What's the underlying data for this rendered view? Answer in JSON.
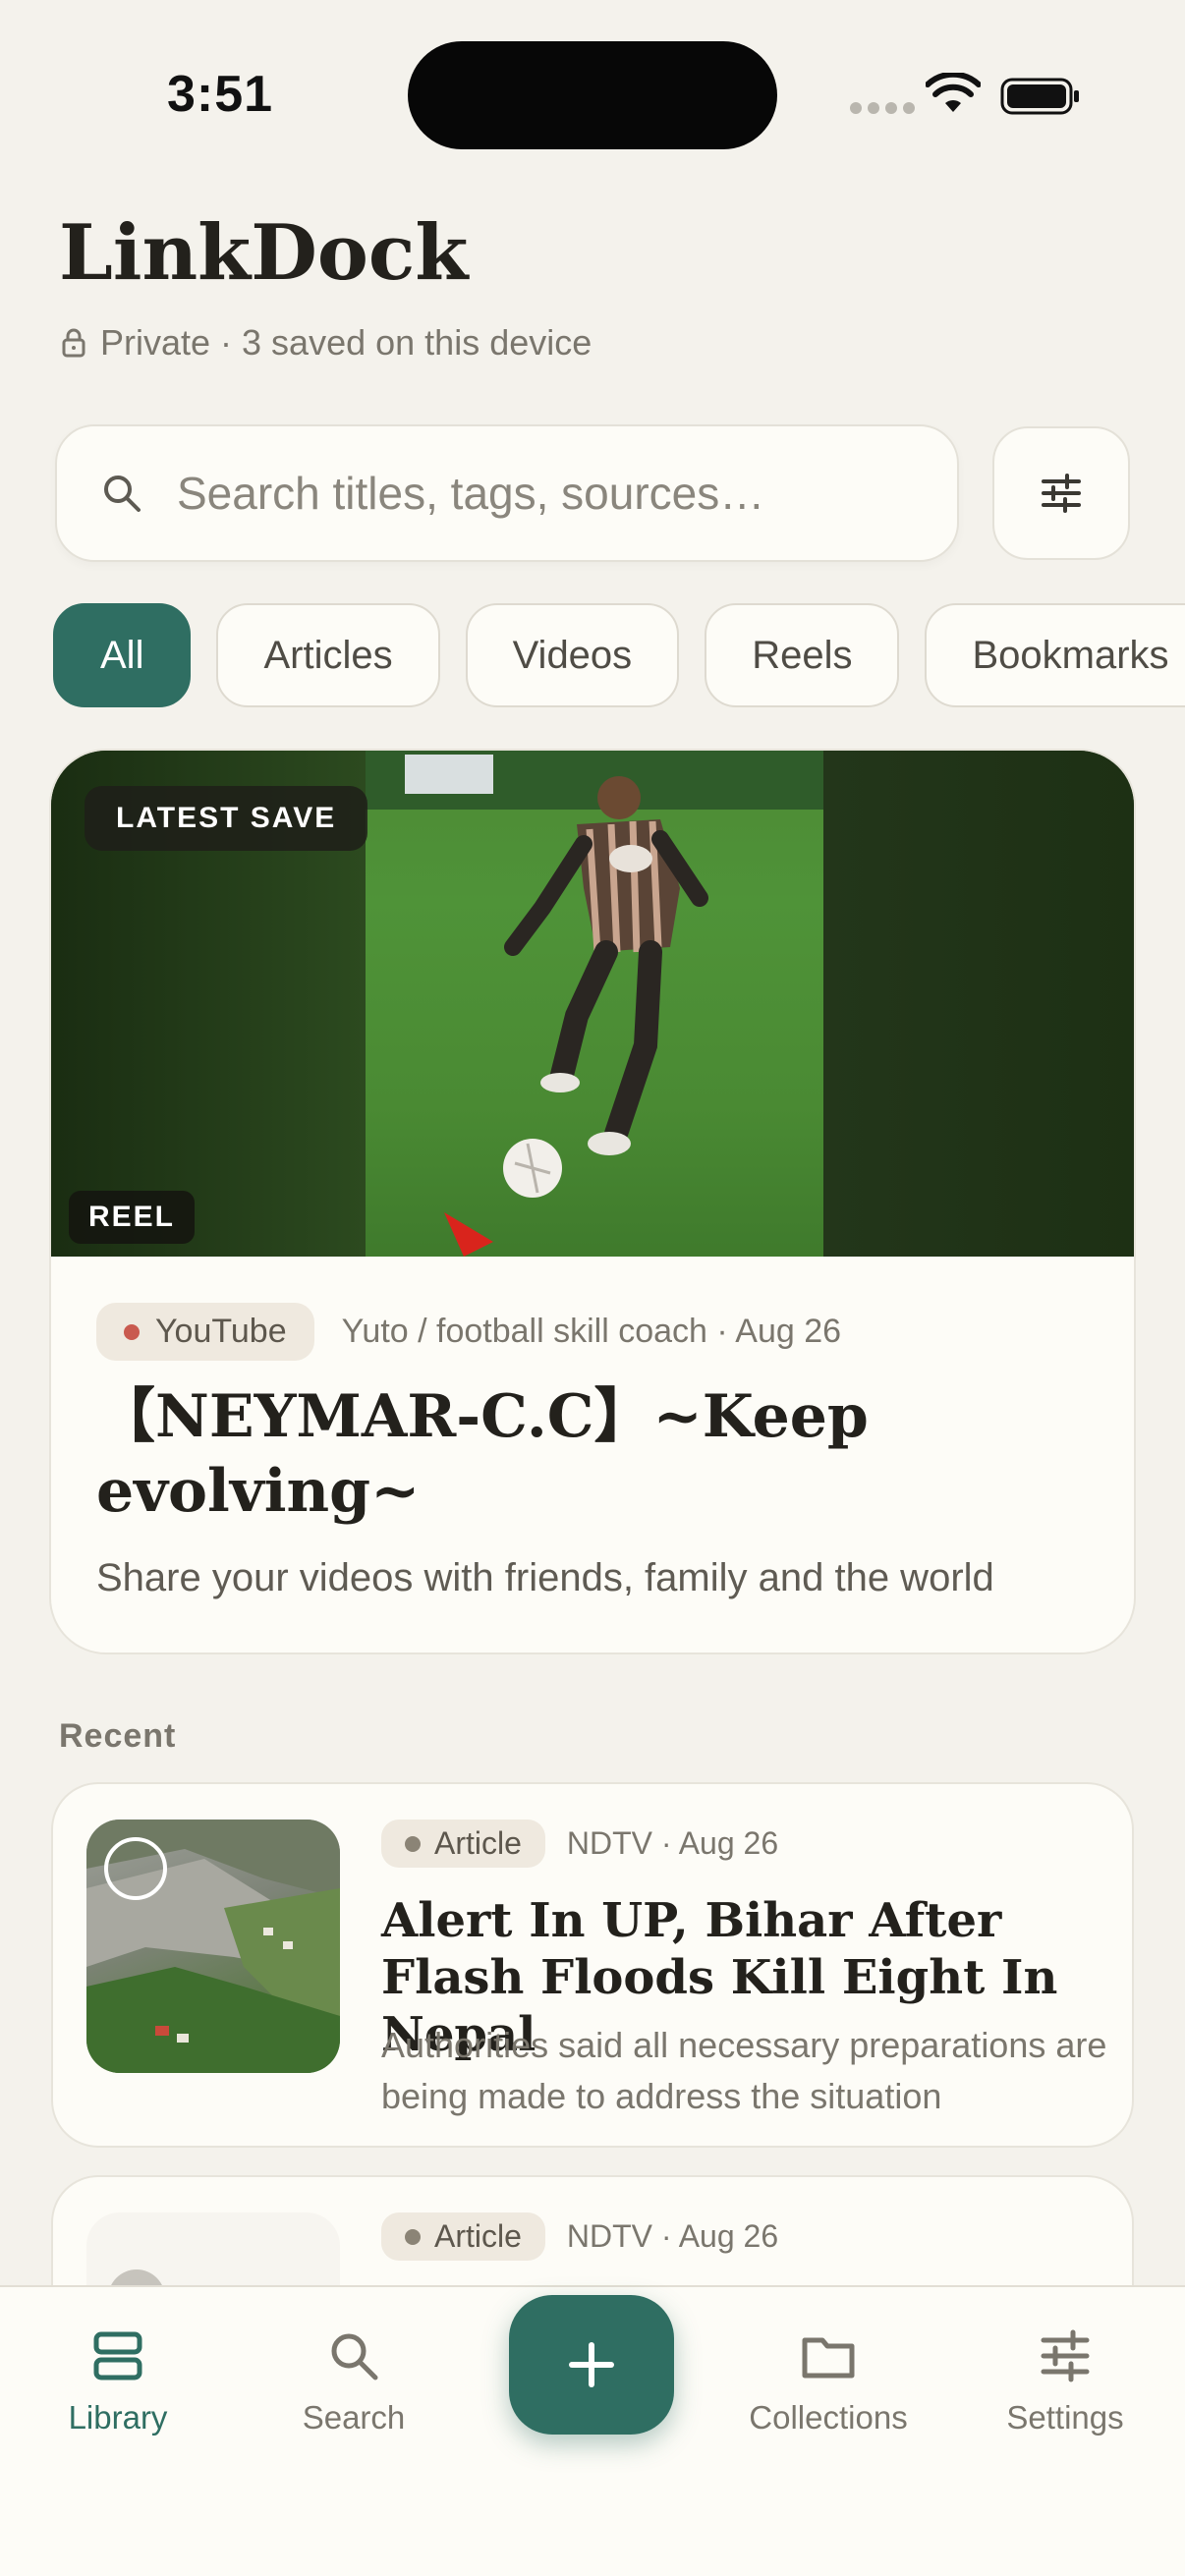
{
  "status_bar": {
    "time": "3:51"
  },
  "header": {
    "title": "LinkDock",
    "privacy_text": "Private · 3 saved on this device"
  },
  "search": {
    "placeholder": "Search titles, tags, sources…"
  },
  "filters": [
    {
      "label": "All",
      "active": true
    },
    {
      "label": "Articles",
      "active": false
    },
    {
      "label": "Videos",
      "active": false
    },
    {
      "label": "Reels",
      "active": false
    },
    {
      "label": "Bookmarks",
      "active": false
    }
  ],
  "featured": {
    "badge": "LATEST SAVE",
    "type_badge": "REEL",
    "source": "YouTube",
    "meta": "Yuto /  football skill coach · Aug 26",
    "title": "【NEYMAR-C.C】~Keep evolving~",
    "description": "Share your videos with friends, family and the world"
  },
  "recent": {
    "label": "Recent",
    "items": [
      {
        "type": "Article",
        "meta": "NDTV · Aug 26",
        "title": "Alert In UP, Bihar After Flash Floods Kill Eight In Nepal",
        "description": "Authorities said all necessary preparations are being made to address the situation"
      },
      {
        "type": "Article",
        "meta": "NDTV · Aug 26"
      }
    ]
  },
  "nav": {
    "library": "Library",
    "search": "Search",
    "collections": "Collections",
    "settings": "Settings"
  },
  "colors": {
    "accent": "#2f6e62",
    "background": "#f4f2ec",
    "card": "#fdfcf7",
    "youtube_dot": "#c95a4f"
  }
}
